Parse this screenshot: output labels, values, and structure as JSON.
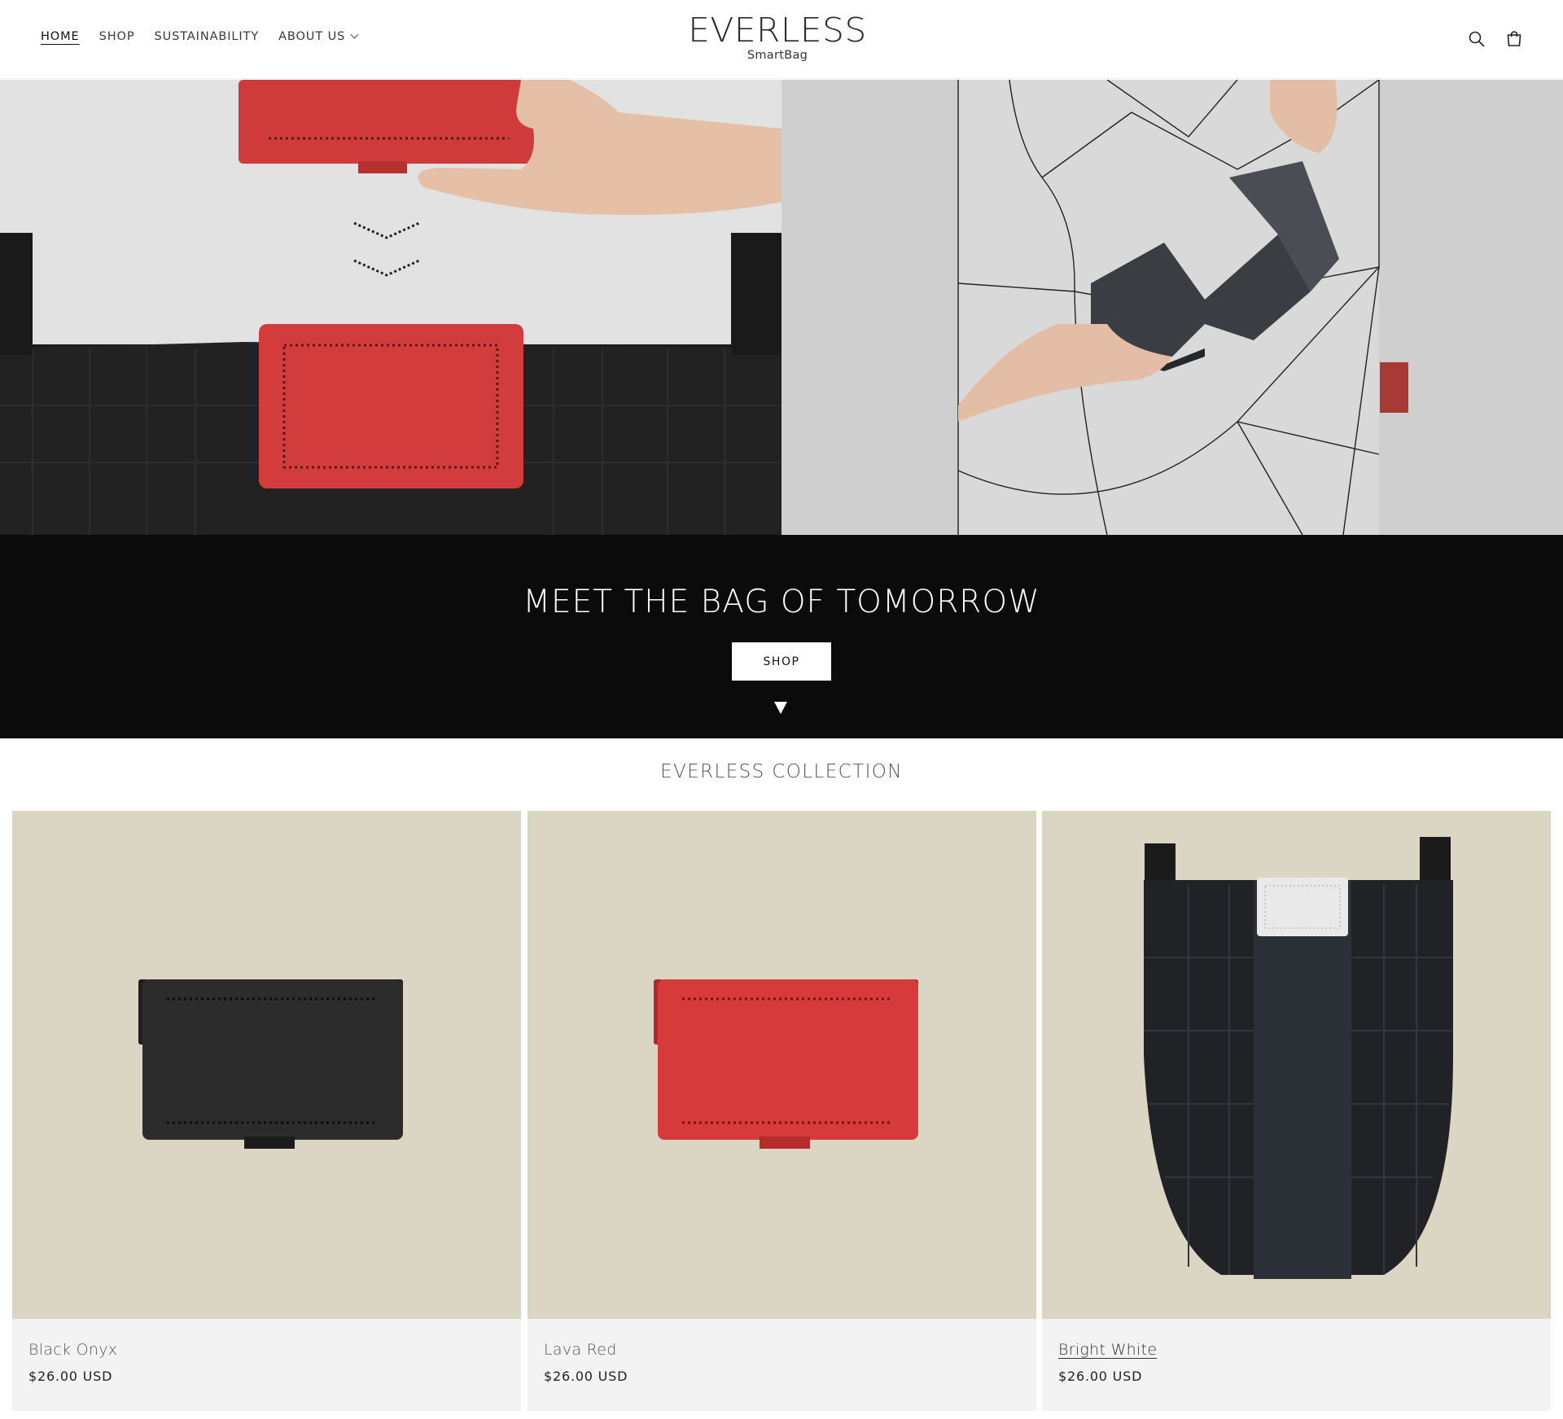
{
  "header": {
    "nav": [
      {
        "label": "HOME"
      },
      {
        "label": "SHOP"
      },
      {
        "label": "SUSTAINABILITY"
      },
      {
        "label": "ABOUT US"
      }
    ],
    "logo": {
      "title": "EVERLESS",
      "subtitle": "SmartBag"
    },
    "icons": [
      "search-icon",
      "cart-icon"
    ]
  },
  "hero": {
    "title": "MEET THE BAG OF TOMORROW",
    "button_label": "SHOP"
  },
  "collection": {
    "title": "EVERLESS COLLECTION",
    "products": [
      {
        "name": "Black Onyx",
        "price": "$26.00 USD"
      },
      {
        "name": "Lava Red",
        "price": "$26.00 USD"
      },
      {
        "name": "Bright White",
        "price": "$26.00 USD"
      }
    ]
  },
  "colors": {
    "banner_bg": "#0b0b0b",
    "product_bg": "#dbd6c4",
    "accent_red": "#d63a3a"
  }
}
